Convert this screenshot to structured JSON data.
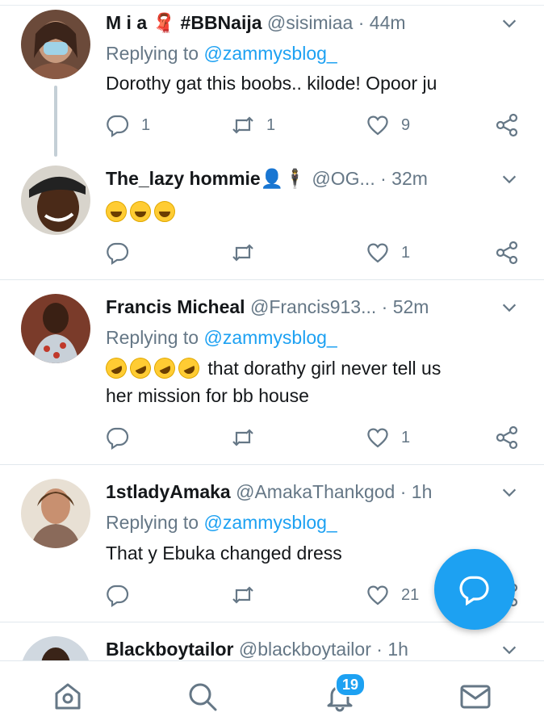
{
  "tweets": [
    {
      "name": "M i a 🧣 #BBNaija",
      "handle": "@sisimiaa",
      "time": "44m",
      "replying_prefix": "Replying to ",
      "replying_to": "@zammysblog_",
      "text": "Dorothy gat this boobs.. kilode! Opoor ju",
      "replies": "1",
      "retweets": "1",
      "likes": "9"
    },
    {
      "name": "The_lazy hommie👤🕴",
      "handle": "@OG...",
      "time": "32m",
      "replies": "",
      "retweets": "",
      "likes": "1"
    },
    {
      "name": "Francis Micheal",
      "handle": "@Francis913...",
      "time": "52m",
      "replying_prefix": "Replying to ",
      "replying_to": "@zammysblog_",
      "text_line1": "that dorathy girl never tell us",
      "text_line2": "her mission for bb house",
      "replies": "",
      "retweets": "",
      "likes": "1"
    },
    {
      "name": "1stladyAmaka",
      "handle": "@AmakaThankgod",
      "time": "1h",
      "replying_prefix": "Replying to ",
      "replying_to": "@zammysblog_",
      "text": "That y Ebuka changed dress",
      "replies": "",
      "retweets": "",
      "likes": "21"
    },
    {
      "name": "Blackboytailor",
      "handle": "@blackboytailor",
      "time": "1h"
    }
  ],
  "nav": {
    "notifications_badge": "19"
  },
  "colors": {
    "accent": "#1da1f2",
    "secondary_text": "#657786",
    "divider": "#e1e8ed"
  },
  "icons": [
    "reply-icon",
    "retweet-icon",
    "like-icon",
    "share-icon",
    "chevron-down-icon",
    "home-icon",
    "search-icon",
    "bell-icon",
    "mail-icon",
    "compose-reply-icon"
  ]
}
